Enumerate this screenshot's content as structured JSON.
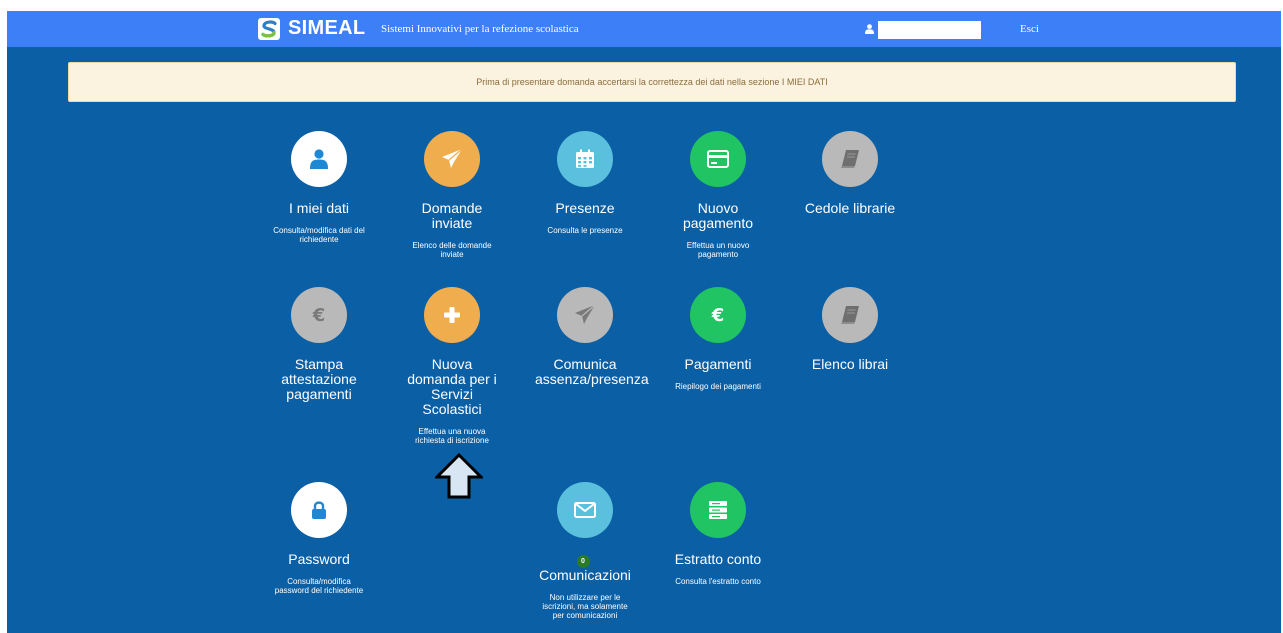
{
  "colors": {
    "background": "#0b5fa5",
    "topbar": "#3d7ff7",
    "white": "#ffffff",
    "orange": "#f0ad4e",
    "light_blue": "#5bc0de",
    "green": "#20c463",
    "grey": "#b9b9b9",
    "notice_bg": "#fcf2e0",
    "notice_text": "#8a6d3b",
    "badge": "#2b7a28"
  },
  "header": {
    "brand": "SIMEAL",
    "tagline": "Sistemi Innovativi per la refezione scolastica",
    "user_icon": "user-icon",
    "user_value": "",
    "logout": "Esci"
  },
  "notice": "Prima di presentare domanda accertarsi la correttezza dei dati nella sezione I MIEI DATI",
  "tiles": [
    {
      "title": "I miei dati",
      "desc": "Consulta/modifica dati del richiedente",
      "icon": "user-icon",
      "color": "white"
    },
    {
      "title": "Domande inviate",
      "desc": "Elenco delle domande inviate",
      "icon": "paper-plane-icon",
      "color": "orange"
    },
    {
      "title": "Presenze",
      "desc": "Consulta le presenze",
      "icon": "calendar-icon",
      "color": "light_blue"
    },
    {
      "title": "Nuovo pagamento",
      "desc": "Effettua un nuovo pagamento",
      "icon": "credit-card-icon",
      "color": "green"
    },
    {
      "title": "Cedole librarie",
      "desc": "",
      "icon": "book-icon",
      "color": "grey"
    },
    {
      "title": "Stampa attestazione pagamenti",
      "desc": "",
      "icon": "euro-icon",
      "color": "grey"
    },
    {
      "title": "Nuova domanda per i Servizi Scolastici",
      "desc": "Effettua una nuova richiesta di iscrizione",
      "icon": "plus-icon",
      "color": "orange"
    },
    {
      "title": "Comunica assenza/presenza",
      "desc": "",
      "icon": "paper-plane-icon",
      "color": "grey"
    },
    {
      "title": "Pagamenti",
      "desc": "Riepilogo dei pagamenti",
      "icon": "euro-icon",
      "color": "green"
    },
    {
      "title": "Elenco librai",
      "desc": "",
      "icon": "book-icon",
      "color": "grey"
    },
    {
      "title": "Password",
      "desc": "Consulta/modifica password del richiedente",
      "icon": "lock-icon",
      "color": "white"
    },
    {
      "title": "Comunicazioni",
      "badge": "0",
      "desc": "Non utilizzare per le iscrizioni, ma solamente per comunicazioni",
      "icon": "envelope-icon",
      "color": "light_blue"
    },
    {
      "title": "Estratto conto",
      "desc": "Consulta l'estratto conto",
      "icon": "server-icon",
      "color": "green"
    }
  ],
  "pointer_icon": "arrow-up-icon"
}
